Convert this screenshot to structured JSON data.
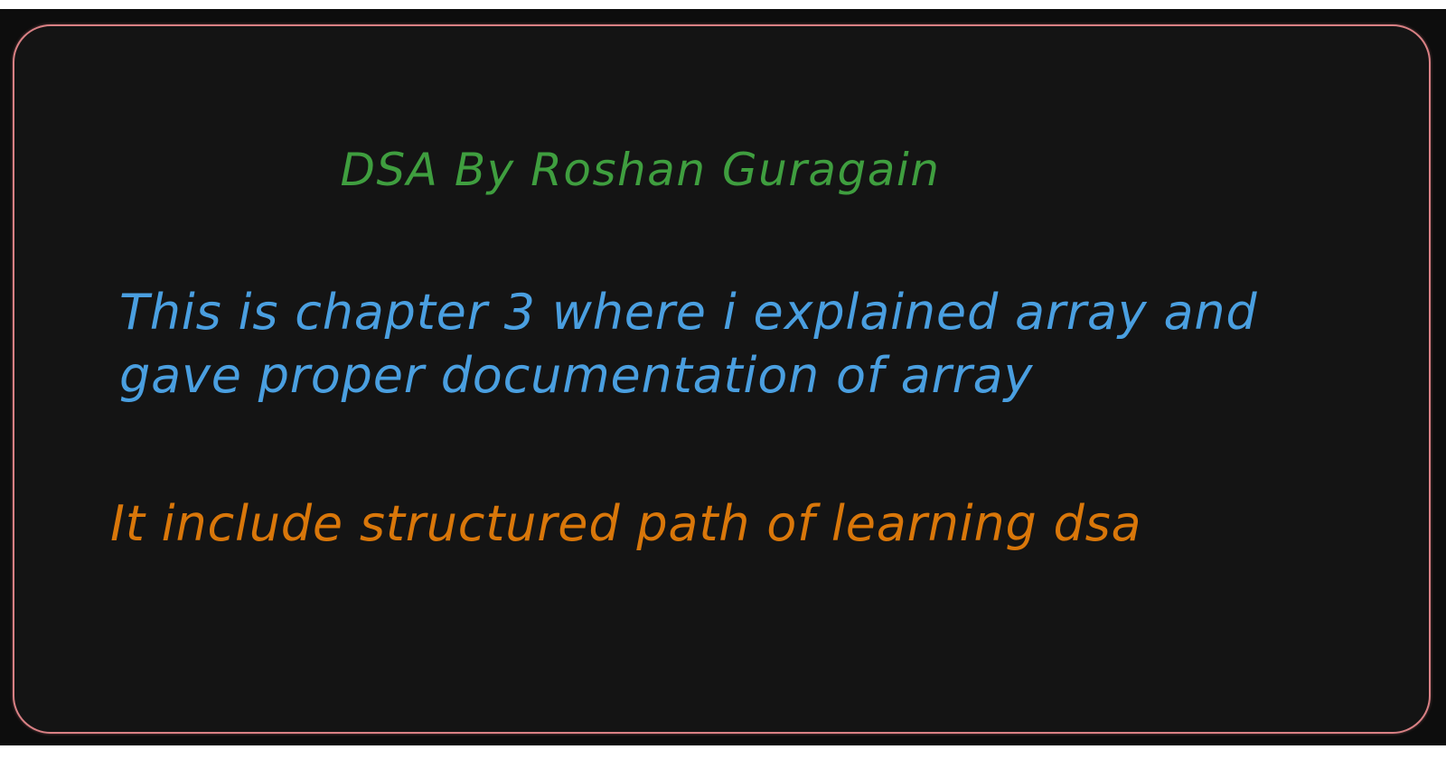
{
  "card": {
    "border_color": "#d98084",
    "background_color": "#141414",
    "page_background_color": "#0d0d0d",
    "corner_radius_px": 42
  },
  "title": {
    "text": "DSA By Roshan Guragain",
    "color": "#3f9e3f"
  },
  "blue_note": {
    "color": "#4a9fe0",
    "lines": [
      "This is chapter 3 where i explained array and",
      "gave proper documentation of array"
    ]
  },
  "orange_note": {
    "color": "#d9770a",
    "lines": [
      "It include structured path of learning dsa"
    ]
  }
}
